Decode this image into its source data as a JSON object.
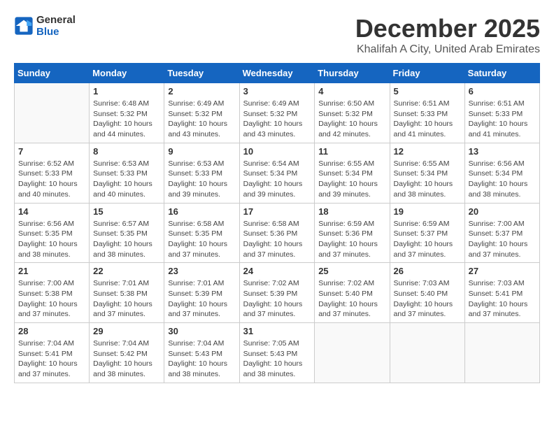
{
  "header": {
    "logo_line1": "General",
    "logo_line2": "Blue",
    "month_title": "December 2025",
    "subtitle": "Khalifah A City, United Arab Emirates"
  },
  "weekdays": [
    "Sunday",
    "Monday",
    "Tuesday",
    "Wednesday",
    "Thursday",
    "Friday",
    "Saturday"
  ],
  "weeks": [
    [
      {
        "day": "",
        "info": ""
      },
      {
        "day": "1",
        "info": "Sunrise: 6:48 AM\nSunset: 5:32 PM\nDaylight: 10 hours\nand 44 minutes."
      },
      {
        "day": "2",
        "info": "Sunrise: 6:49 AM\nSunset: 5:32 PM\nDaylight: 10 hours\nand 43 minutes."
      },
      {
        "day": "3",
        "info": "Sunrise: 6:49 AM\nSunset: 5:32 PM\nDaylight: 10 hours\nand 43 minutes."
      },
      {
        "day": "4",
        "info": "Sunrise: 6:50 AM\nSunset: 5:32 PM\nDaylight: 10 hours\nand 42 minutes."
      },
      {
        "day": "5",
        "info": "Sunrise: 6:51 AM\nSunset: 5:33 PM\nDaylight: 10 hours\nand 41 minutes."
      },
      {
        "day": "6",
        "info": "Sunrise: 6:51 AM\nSunset: 5:33 PM\nDaylight: 10 hours\nand 41 minutes."
      }
    ],
    [
      {
        "day": "7",
        "info": "Sunrise: 6:52 AM\nSunset: 5:33 PM\nDaylight: 10 hours\nand 40 minutes."
      },
      {
        "day": "8",
        "info": "Sunrise: 6:53 AM\nSunset: 5:33 PM\nDaylight: 10 hours\nand 40 minutes."
      },
      {
        "day": "9",
        "info": "Sunrise: 6:53 AM\nSunset: 5:33 PM\nDaylight: 10 hours\nand 39 minutes."
      },
      {
        "day": "10",
        "info": "Sunrise: 6:54 AM\nSunset: 5:34 PM\nDaylight: 10 hours\nand 39 minutes."
      },
      {
        "day": "11",
        "info": "Sunrise: 6:55 AM\nSunset: 5:34 PM\nDaylight: 10 hours\nand 39 minutes."
      },
      {
        "day": "12",
        "info": "Sunrise: 6:55 AM\nSunset: 5:34 PM\nDaylight: 10 hours\nand 38 minutes."
      },
      {
        "day": "13",
        "info": "Sunrise: 6:56 AM\nSunset: 5:34 PM\nDaylight: 10 hours\nand 38 minutes."
      }
    ],
    [
      {
        "day": "14",
        "info": "Sunrise: 6:56 AM\nSunset: 5:35 PM\nDaylight: 10 hours\nand 38 minutes."
      },
      {
        "day": "15",
        "info": "Sunrise: 6:57 AM\nSunset: 5:35 PM\nDaylight: 10 hours\nand 38 minutes."
      },
      {
        "day": "16",
        "info": "Sunrise: 6:58 AM\nSunset: 5:35 PM\nDaylight: 10 hours\nand 37 minutes."
      },
      {
        "day": "17",
        "info": "Sunrise: 6:58 AM\nSunset: 5:36 PM\nDaylight: 10 hours\nand 37 minutes."
      },
      {
        "day": "18",
        "info": "Sunrise: 6:59 AM\nSunset: 5:36 PM\nDaylight: 10 hours\nand 37 minutes."
      },
      {
        "day": "19",
        "info": "Sunrise: 6:59 AM\nSunset: 5:37 PM\nDaylight: 10 hours\nand 37 minutes."
      },
      {
        "day": "20",
        "info": "Sunrise: 7:00 AM\nSunset: 5:37 PM\nDaylight: 10 hours\nand 37 minutes."
      }
    ],
    [
      {
        "day": "21",
        "info": "Sunrise: 7:00 AM\nSunset: 5:38 PM\nDaylight: 10 hours\nand 37 minutes."
      },
      {
        "day": "22",
        "info": "Sunrise: 7:01 AM\nSunset: 5:38 PM\nDaylight: 10 hours\nand 37 minutes."
      },
      {
        "day": "23",
        "info": "Sunrise: 7:01 AM\nSunset: 5:39 PM\nDaylight: 10 hours\nand 37 minutes."
      },
      {
        "day": "24",
        "info": "Sunrise: 7:02 AM\nSunset: 5:39 PM\nDaylight: 10 hours\nand 37 minutes."
      },
      {
        "day": "25",
        "info": "Sunrise: 7:02 AM\nSunset: 5:40 PM\nDaylight: 10 hours\nand 37 minutes."
      },
      {
        "day": "26",
        "info": "Sunrise: 7:03 AM\nSunset: 5:40 PM\nDaylight: 10 hours\nand 37 minutes."
      },
      {
        "day": "27",
        "info": "Sunrise: 7:03 AM\nSunset: 5:41 PM\nDaylight: 10 hours\nand 37 minutes."
      }
    ],
    [
      {
        "day": "28",
        "info": "Sunrise: 7:04 AM\nSunset: 5:41 PM\nDaylight: 10 hours\nand 37 minutes."
      },
      {
        "day": "29",
        "info": "Sunrise: 7:04 AM\nSunset: 5:42 PM\nDaylight: 10 hours\nand 38 minutes."
      },
      {
        "day": "30",
        "info": "Sunrise: 7:04 AM\nSunset: 5:43 PM\nDaylight: 10 hours\nand 38 minutes."
      },
      {
        "day": "31",
        "info": "Sunrise: 7:05 AM\nSunset: 5:43 PM\nDaylight: 10 hours\nand 38 minutes."
      },
      {
        "day": "",
        "info": ""
      },
      {
        "day": "",
        "info": ""
      },
      {
        "day": "",
        "info": ""
      }
    ]
  ]
}
